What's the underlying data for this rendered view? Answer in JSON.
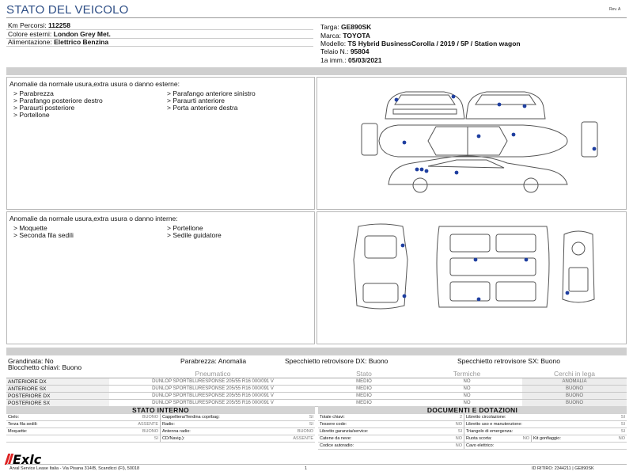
{
  "header": {
    "title": "STATO DEL VEICOLO",
    "rev": "Rev. A"
  },
  "vehicle": {
    "left": [
      {
        "label": "Km Percorsi:",
        "value": "112258"
      },
      {
        "label": "Colore esterni:",
        "value": "London Grey Met."
      },
      {
        "label": "Alimentazione:",
        "value": "Elettrico Benzina"
      }
    ],
    "right": [
      {
        "label": "Targa:",
        "value": "GE890SK"
      },
      {
        "label": "Marca:",
        "value": "TOYOTA"
      },
      {
        "label": "Modello:",
        "value": "TS Hybrid BusinessCorolla / 2019 / 5P / Station wagon"
      },
      {
        "label": "Telaio N.:",
        "value": "95804"
      },
      {
        "label": "1a imm.:",
        "value": "05/03/2021"
      }
    ]
  },
  "exterior": {
    "title": "Anomalie da normale usura,extra usura o danno esterne:",
    "col1": [
      "> Parabrezza",
      "> Parafango posteriore destro",
      "> Paraurti posteriore",
      "> Portellone"
    ],
    "col2": [
      "> Parafango anteriore sinistro",
      "> Paraurti anteriore",
      "> Porta anteriore destra"
    ]
  },
  "interior": {
    "title": "Anomalie da normale usura,extra usura o danno interne:",
    "col1": [
      "> Moquette",
      "> Seconda fila sedili"
    ],
    "col2": [
      "> Portellone",
      "> Sedile guidatore"
    ]
  },
  "status": {
    "line1": [
      "Grandinata: No",
      "Parabrezza: Anomalia",
      "Specchietto retrovisore DX: Buono",
      "Specchietto retrovisore SX: Buono"
    ],
    "line2": "Blocchetto chiavi: Buono"
  },
  "tyres": {
    "headers": [
      "Pneumatico",
      "Stato",
      "Termiche",
      "Cerchi in lega"
    ],
    "rows": [
      {
        "pos": "ANTERIORE DX",
        "tyre": "DUNLOP  SPORTBLURESPONSE  205/55 R16 000/091 V",
        "stato": "MEDIO",
        "termiche": "NO",
        "cerchi": "ANOMALIA"
      },
      {
        "pos": "ANTERIORE SX",
        "tyre": "DUNLOP  SPORTBLURESPONSE  205/55 R16 000/091 V",
        "stato": "MEDIO",
        "termiche": "NO",
        "cerchi": "BUONO"
      },
      {
        "pos": "POSTERIORE DX",
        "tyre": "DUNLOP  SPORTBLURESPONSE  205/55 R16 000/091 V",
        "stato": "MEDIO",
        "termiche": "NO",
        "cerchi": "BUONO"
      },
      {
        "pos": "POSTERIORE SX",
        "tyre": "DUNLOP  SPORTBLURESPONSE  205/55 R16 000/091 V",
        "stato": "MEDIO",
        "termiche": "NO",
        "cerchi": "BUONO"
      }
    ]
  },
  "stato_interno": {
    "title": "STATO INTERNO",
    "rows": [
      [
        {
          "l": "Cielo:",
          "v": "BUONO"
        },
        {
          "l": "Cappelliera/Tendina copribag:",
          "v": "SI"
        }
      ],
      [
        {
          "l": "Terza fila sedili:",
          "v": "ASSENTE"
        },
        {
          "l": "Radio:",
          "v": "SI"
        }
      ],
      [
        {
          "l": "Moquette:",
          "v": "BUONO"
        },
        {
          "l": "Antenna radio:",
          "v": "BUONO"
        }
      ],
      [
        {
          "l": "",
          "v": "SI"
        },
        {
          "l": "CD/Navig.):",
          "v": "ASSENTE"
        }
      ]
    ]
  },
  "documenti": {
    "title": "DOCUMENTI E DOTAZIONI",
    "rows": [
      [
        {
          "l": "Totale chiavi:",
          "v": "2"
        },
        {
          "l": "Libretto circolazione:",
          "v": "SI"
        }
      ],
      [
        {
          "l": "Tessere code:",
          "v": "NO"
        },
        {
          "l": "Libretto uso e manutenzione:",
          "v": "SI"
        }
      ],
      [
        {
          "l": "Libretto garanzia/service:",
          "v": "SI"
        },
        {
          "l": "Triangolo di emergenza:",
          "v": "SI"
        }
      ],
      [
        {
          "l": "Catene da neve:",
          "v": "NO"
        },
        {
          "l": "Ruota scorta:",
          "v": "NO"
        },
        {
          "l": "Kit gonfiaggio:",
          "v": "NO"
        }
      ],
      [
        {
          "l": "Codice autoradio:",
          "v": "NO"
        },
        {
          "l": "Cavo elettrico:",
          "v": ""
        }
      ]
    ]
  },
  "footer": {
    "left": "Arval Service Lease Italia - Via Pisana 314/B, Scandicci (FI), 50018",
    "page": "1",
    "right": "ID RITIRO: 2344211 | GE890SK"
  },
  "logo": {
    "text": "Exlc"
  },
  "colors": {
    "title": "#2f4f86",
    "marker": "#1f3fa0",
    "bar": "#cfcfcf"
  }
}
